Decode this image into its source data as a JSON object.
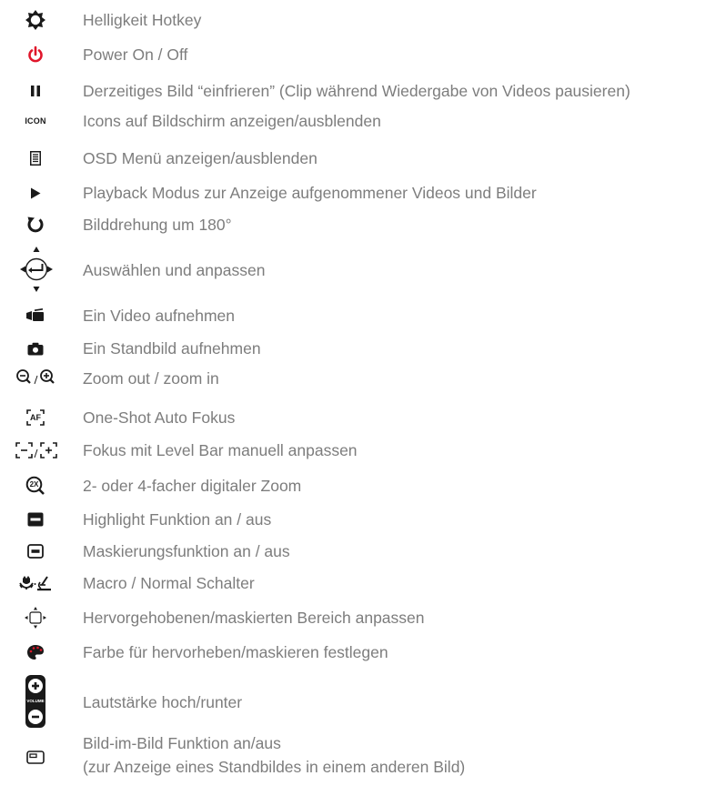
{
  "items": [
    {
      "icon": "brightness-icon",
      "label": "Helligkeit Hotkey"
    },
    {
      "icon": "power-icon",
      "label": "Power On / Off"
    },
    {
      "icon": "pause-icon",
      "label": "Derzeitiges Bild “einfrieren” (Clip während Wiedergabe von Videos pausieren)"
    },
    {
      "icon": "icon-text-icon",
      "label": "Icons auf Bildschirm anzeigen/ausblenden",
      "icon_text": "ICON"
    },
    {
      "icon": "menu-icon",
      "label": "OSD Menü anzeigen/ausblenden"
    },
    {
      "icon": "play-icon",
      "label": "Playback Modus zur Anzeige aufgenommener Videos und Bilder"
    },
    {
      "icon": "rotate-icon",
      "label": "Bilddrehung um 180°"
    },
    {
      "icon": "navigation-enter-icon",
      "label": "Auswählen und anpassen"
    },
    {
      "icon": "video-camera-icon",
      "label": "Ein Video aufnehmen"
    },
    {
      "icon": "camera-icon",
      "label": "Ein Standbild aufnehmen"
    },
    {
      "icon": "zoom-out-in-icon",
      "label": "Zoom out / zoom in"
    },
    {
      "icon": "autofocus-icon",
      "label": "One-Shot Auto Fokus",
      "icon_text": "AF"
    },
    {
      "icon": "manual-focus-icon",
      "label": "Fokus mit Level Bar manuell anpassen"
    },
    {
      "icon": "digital-zoom-icon",
      "label": "2- oder 4-facher digitaler Zoom",
      "icon_text": "2X"
    },
    {
      "icon": "highlight-icon",
      "label": "Highlight Funktion an / aus"
    },
    {
      "icon": "mask-icon",
      "label": "Maskierungsfunktion an / aus"
    },
    {
      "icon": "macro-normal-icon",
      "label": "Macro / Normal Schalter"
    },
    {
      "icon": "adjust-area-icon",
      "label": "Hervorgehobenen/maskierten Bereich anpassen"
    },
    {
      "icon": "palette-icon",
      "label": "Farbe für hervorheben/maskieren festlegen"
    },
    {
      "icon": "volume-icon",
      "label": "Lautstärke hoch/runter",
      "icon_text": "VOLUME"
    },
    {
      "icon": "picture-in-picture-icon",
      "label": "Bild-im-Bild Funktion an/aus",
      "label2": "(zur Anzeige eines Standbildes in einem anderen Bild)"
    }
  ],
  "colors": {
    "text": "#7d7d7d",
    "icon": "#1a1a1a",
    "power": "#e0162b"
  }
}
